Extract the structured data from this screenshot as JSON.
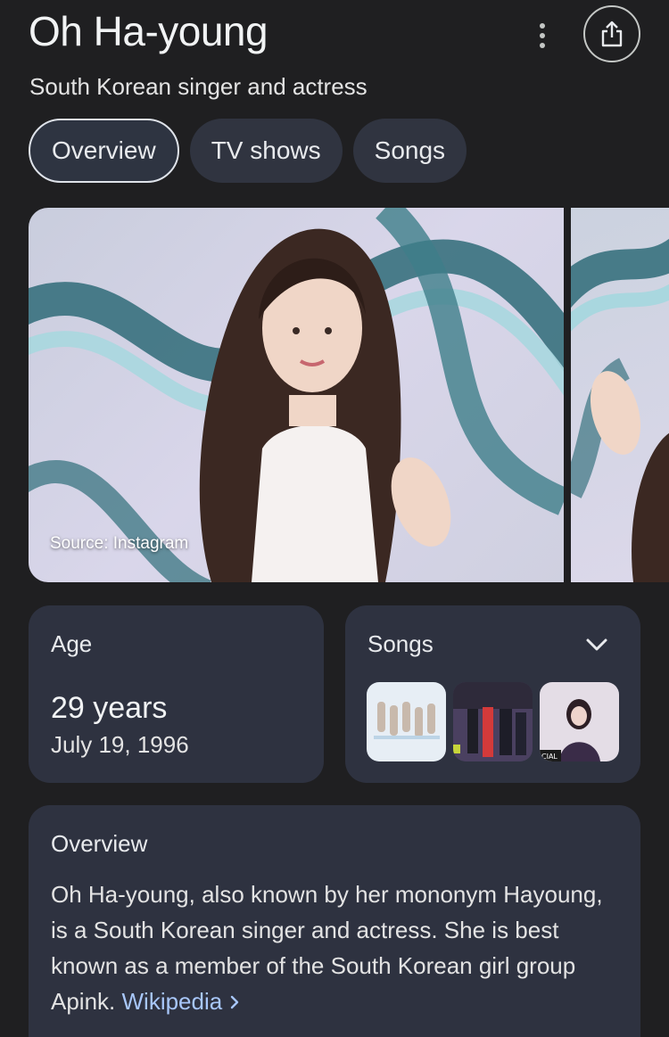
{
  "header": {
    "title": "Oh Ha-young",
    "subtitle": "South Korean singer and actress"
  },
  "tabs": [
    {
      "label": "Overview",
      "active": true
    },
    {
      "label": "TV shows",
      "active": false
    },
    {
      "label": "Songs",
      "active": false
    }
  ],
  "images": {
    "source_label": "Source: Instagram"
  },
  "age_card": {
    "label": "Age",
    "value": "29 years",
    "date": "July 19, 1996"
  },
  "songs_card": {
    "label": "Songs",
    "thumbnail_overlay_text": "CIAL"
  },
  "overview_card": {
    "label": "Overview",
    "text": "Oh Ha-young, also known by her mononym Hayoung, is a South Korean singer and actress. She is best known as a member of the South Korean girl group Apink.",
    "link_label": "Wikipedia",
    "link_icon": "chevron-right-icon"
  },
  "colors": {
    "background": "#1f1f21",
    "card": "#2e3240",
    "link": "#a8c7fa"
  }
}
